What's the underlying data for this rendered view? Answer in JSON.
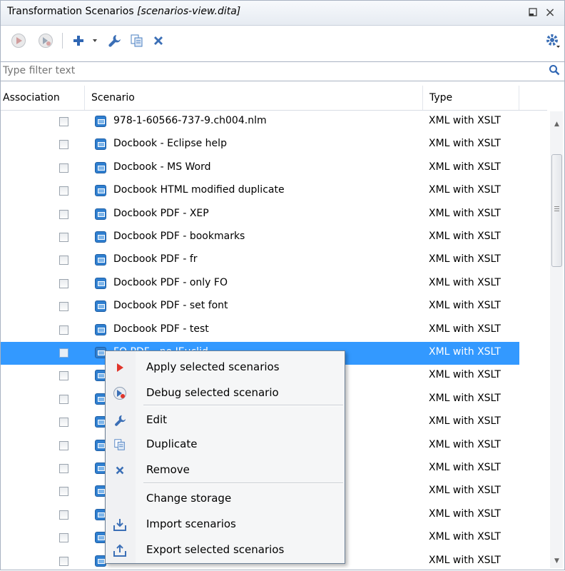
{
  "panel": {
    "title": "Transformation Scenarios",
    "title_file": "[scenarios-view.dita]",
    "minimize_glyph": "◻",
    "close_glyph": "×"
  },
  "toolbar": {
    "icons": [
      "run-icon",
      "debug-icon",
      "add-icon",
      "dropdown-arrow-icon",
      "wrench-icon",
      "duplicate-icon",
      "remove-icon",
      "gear-icon"
    ]
  },
  "filter": {
    "placeholder": "Type filter text"
  },
  "table": {
    "headers": {
      "association": "Association",
      "scenario": "Scenario",
      "type": "Type"
    },
    "rows": [
      {
        "name": "978-1-60566-737-9.ch004.nlm",
        "type": "XML with XSLT"
      },
      {
        "name": "Docbook - Eclipse help",
        "type": "XML with XSLT"
      },
      {
        "name": "Docbook - MS Word",
        "type": "XML with XSLT"
      },
      {
        "name": "Docbook HTML modified duplicate",
        "type": "XML with XSLT"
      },
      {
        "name": "Docbook PDF - XEP",
        "type": "XML with XSLT"
      },
      {
        "name": "Docbook PDF - bookmarks",
        "type": "XML with XSLT"
      },
      {
        "name": "Docbook PDF - fr",
        "type": "XML with XSLT"
      },
      {
        "name": "Docbook PDF - only FO",
        "type": "XML with XSLT"
      },
      {
        "name": "Docbook PDF - set font",
        "type": "XML with XSLT"
      },
      {
        "name": "Docbook PDF - test",
        "type": "XML with XSLT"
      },
      {
        "name": "FO PDF - no JEuclid",
        "type": "XML with XSLT",
        "selected": true
      },
      {
        "name": "",
        "type": "XML with XSLT"
      },
      {
        "name": "",
        "type": "XML with XSLT"
      },
      {
        "name": "",
        "type": "XML with XSLT"
      },
      {
        "name": "",
        "type": "XML with XSLT"
      },
      {
        "name": "",
        "type": "XML with XSLT"
      },
      {
        "name": "",
        "type": "XML with XSLT"
      },
      {
        "name": "",
        "type": "XML with XSLT"
      },
      {
        "name": "",
        "type": "XML with XSLT"
      },
      {
        "name": "",
        "type": "XML with XSLT"
      }
    ]
  },
  "context_menu": {
    "items": [
      {
        "label": "Apply selected scenarios",
        "icon": "run-icon"
      },
      {
        "label": "Debug selected scenario",
        "icon": "debug-icon"
      },
      {
        "label": "Edit",
        "icon": "wrench-icon"
      },
      {
        "label": "Duplicate",
        "icon": "duplicate-icon"
      },
      {
        "label": "Remove",
        "icon": "remove-icon"
      },
      {
        "label": "Change storage",
        "icon": ""
      },
      {
        "label": "Import scenarios",
        "icon": "import-icon"
      },
      {
        "label": "Export selected scenarios",
        "icon": "export-icon"
      }
    ]
  },
  "colors": {
    "selection": "#3399ff",
    "accent_blue": "#2f7fd0",
    "run_red": "#e0352b",
    "remove_blue": "#3b6fb6"
  }
}
